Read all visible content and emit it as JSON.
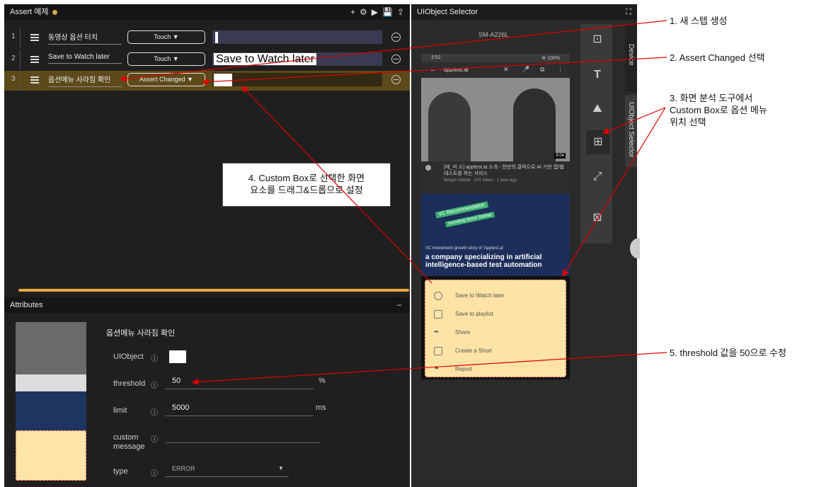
{
  "left": {
    "title": "Assert 예제",
    "steps": [
      {
        "num": "1",
        "desc": "동영상 옵션 터치",
        "action": "Touch ▼",
        "target": ""
      },
      {
        "num": "2",
        "desc": "Save to Watch later",
        "action": "Touch ▼",
        "target": "Save to Watch later"
      },
      {
        "num": "3",
        "desc": "옵션메뉴 사라짐 확인",
        "action": "Assert Changed ▼",
        "target": ""
      }
    ]
  },
  "attributes": {
    "title": "Attributes",
    "collapse": "–",
    "step_name": "옵션메뉴 사라짐 확인",
    "uiobject_label": "UIObject",
    "threshold_label": "threshold",
    "threshold_value": "50",
    "threshold_unit": "%",
    "limit_label": "limit",
    "limit_value": "5000",
    "limit_unit": "ms",
    "custom_label": "custom\nmessage",
    "type_label": "type",
    "type_value": "ERROR"
  },
  "right": {
    "title": "UIObject Selector",
    "device": "SM-A226L",
    "tab_device": "Device",
    "tab_selector": "UIObject Selector"
  },
  "phone": {
    "status_time": "3:52",
    "status_right": "⊕ 100%",
    "search": "apptest.ai",
    "video1_title": "[에_피 소] apptest.ai 소개 - 전반의 클릭으로 AI 기반 앱/웹 테스트를 하는 서비스",
    "video1_meta": "Bespin Global · 374 views · 1 year ago",
    "duration": "8:04",
    "banner1": "VC Recommendation",
    "banner2": "Investing Seoul Startup",
    "video2_sub": "VC investment growth story of 'Apptest.ai'",
    "video2_title": "a company specializing in artificial intelligence-based test automation",
    "menu": [
      "Save to Watch later",
      "Save to playlist",
      "Share",
      "Create a Short",
      "Report"
    ]
  },
  "notes": {
    "n1": "1. 새 스텝 생성",
    "n2": "2. Assert Changed 선택",
    "n3": "3. 화면 분석 도구에서\nCustom Box로 옵션 메뉴\n위치 선택",
    "n4": "4. Custom Box로 선택한 화면\n요소를 드래그&드롭으로 설정",
    "n5": "5. threshold 값을 50으로 수정"
  }
}
